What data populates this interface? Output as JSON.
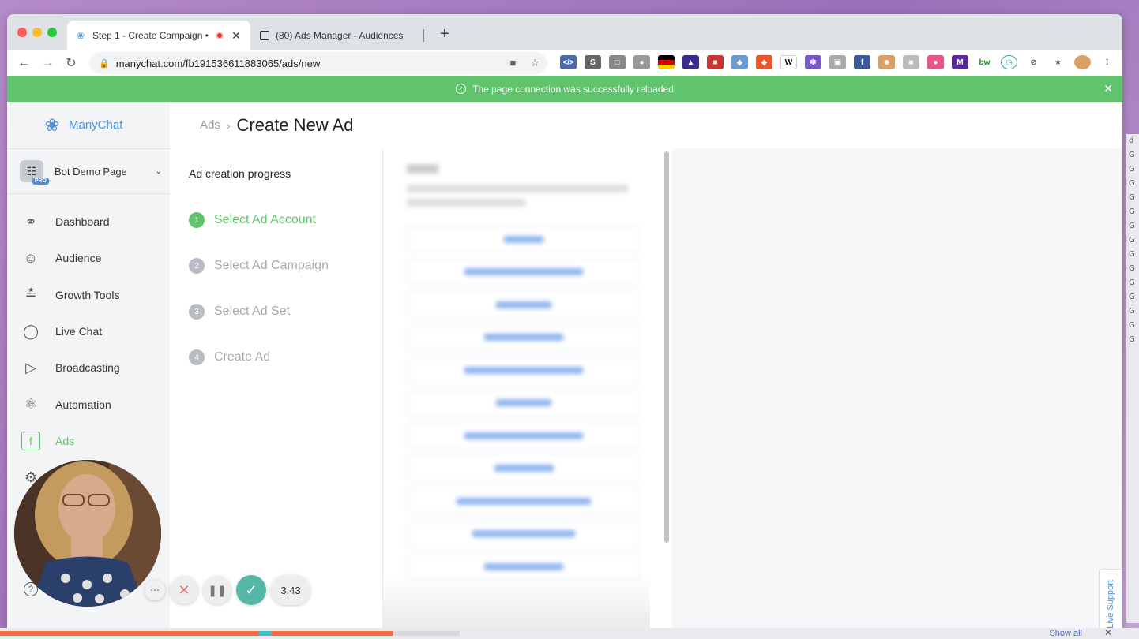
{
  "browser": {
    "tabs": [
      {
        "title": "Step 1 - Create Campaign •",
        "active": true,
        "favicon": "manychat-icon"
      },
      {
        "title": "(80) Ads Manager - Audiences",
        "active": false,
        "favicon": "ads-manager-icon"
      }
    ],
    "url": "manychat.com/fb191536611883065/ads/new"
  },
  "banner": {
    "message": "The page connection was successfully reloaded",
    "color": "#5fc46b"
  },
  "sidebar": {
    "brand": "ManyChat",
    "page_name": "Bot Demo Page",
    "pro_badge": "PRO",
    "items": [
      {
        "label": "Dashboard",
        "icon": "dashboard-gauge-icon"
      },
      {
        "label": "Audience",
        "icon": "person-icon"
      },
      {
        "label": "Growth Tools",
        "icon": "growth-tools-icon"
      },
      {
        "label": "Live Chat",
        "icon": "chat-bubble-icon"
      },
      {
        "label": "Broadcasting",
        "icon": "send-icon"
      },
      {
        "label": "Automation",
        "icon": "automation-icon"
      },
      {
        "label": "Ads",
        "icon": "facebook-icon",
        "active": true
      }
    ]
  },
  "header": {
    "breadcrumb": "Ads",
    "title": "Create New Ad"
  },
  "progress": {
    "title": "Ad creation progress",
    "steps": [
      {
        "num": "1",
        "label": "Select Ad Account",
        "active": true
      },
      {
        "num": "2",
        "label": "Select Ad Campaign",
        "active": false
      },
      {
        "num": "3",
        "label": "Select Ad Set",
        "active": false
      },
      {
        "num": "4",
        "label": "Create Ad",
        "active": false
      }
    ]
  },
  "live_support": "Live Support",
  "recorder": {
    "timer": "3:43"
  },
  "downloads": {
    "show_all": "Show all"
  },
  "colors": {
    "accent_green": "#5fc46b",
    "brand_blue": "#4a90e2"
  }
}
